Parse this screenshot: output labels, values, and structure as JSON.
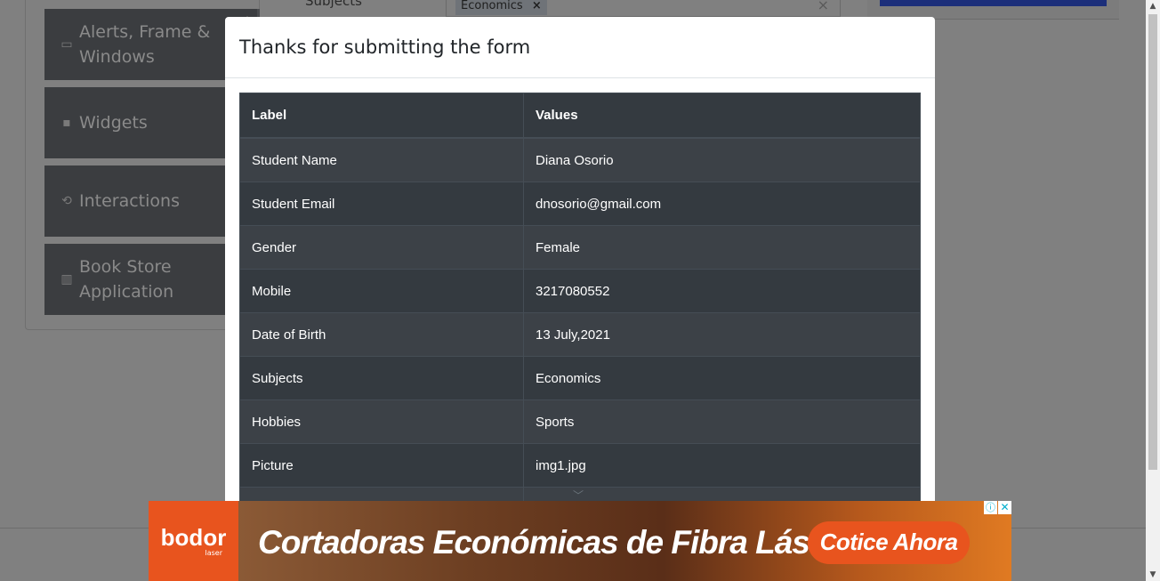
{
  "background": {
    "menu": [
      {
        "icon": "window-icon",
        "label": "Alerts, Frame &",
        "label2": "Windows"
      },
      {
        "icon": "widgets-icon",
        "label": "Widgets",
        "label2": ""
      },
      {
        "icon": "interactions-icon",
        "label": "Interactions",
        "label2": ""
      },
      {
        "icon": "books-icon",
        "label": "Book Store",
        "label2": "Application"
      }
    ],
    "subjects_label": "Subjects",
    "subject_tag": "Economics",
    "subject_tag_remove": "×",
    "clear_icon": "×"
  },
  "modal": {
    "title": "Thanks for submitting the form",
    "columns": [
      "Label",
      "Values"
    ],
    "rows": [
      {
        "label": "Student Name",
        "value": "Diana Osorio"
      },
      {
        "label": "Student Email",
        "value": "dnosorio@gmail.com"
      },
      {
        "label": "Gender",
        "value": "Female"
      },
      {
        "label": "Mobile",
        "value": "3217080552"
      },
      {
        "label": "Date of Birth",
        "value": "13 July,2021"
      },
      {
        "label": "Subjects",
        "value": "Economics"
      },
      {
        "label": "Hobbies",
        "value": "Sports"
      },
      {
        "label": "Picture",
        "value": "img1.jpg"
      },
      {
        "label": "",
        "value": ""
      }
    ]
  },
  "ad": {
    "brand": "bodor",
    "brand_sub": "laser",
    "headline": "Cortadoras Económicas de Fibra Láser",
    "cta": "Cotice Ahora",
    "info_icon": "ⓘ",
    "close_icon": "✕",
    "colors": {
      "brand": "#e8541e"
    }
  },
  "scrollbar": {
    "up": "▲",
    "down": "▼"
  }
}
